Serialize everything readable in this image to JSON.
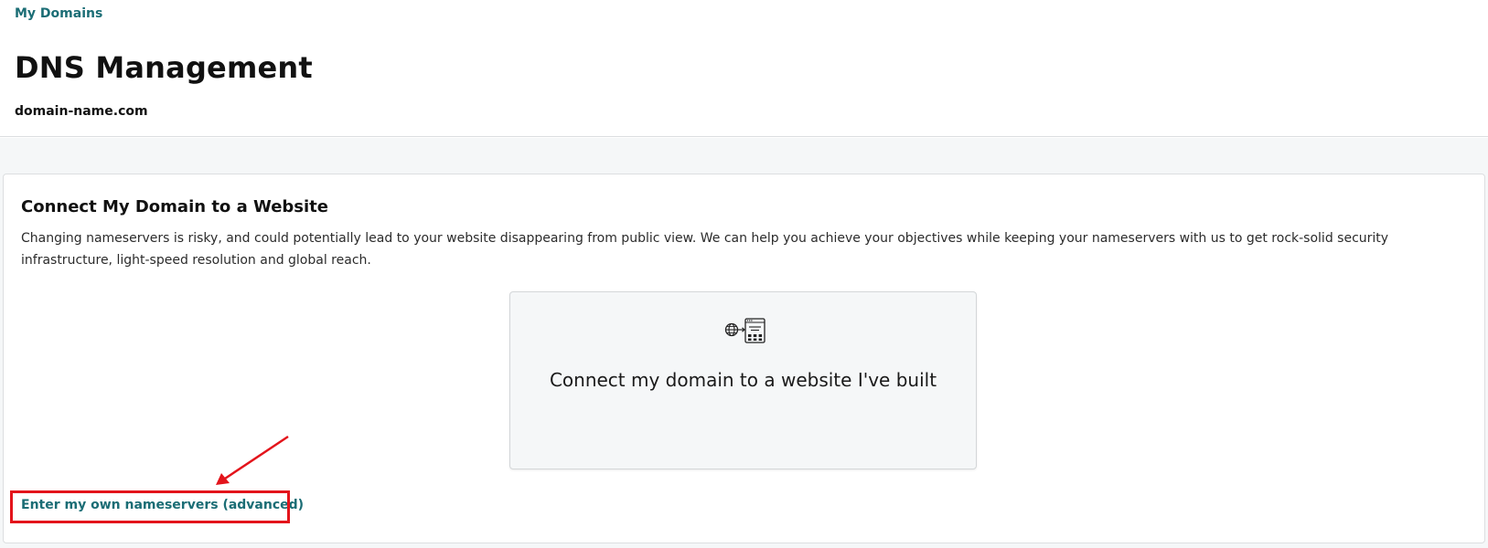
{
  "header": {
    "breadcrumb": "My Domains",
    "title": "DNS Management",
    "domain": "domain-name.com"
  },
  "card": {
    "title": "Connect My Domain to a Website",
    "description": "Changing nameservers is risky, and could potentially lead to your website disappearing from public view. We can help you achieve your objectives while keeping your nameservers with us to get rock-solid security infrastructure, light-speed resolution and global reach.",
    "option": {
      "icon": "globe-to-website-icon",
      "label": "Connect my domain to a website I've built"
    },
    "advanced_link": "Enter my own nameservers (advanced)"
  },
  "annotation": {
    "color": "#e3141b"
  },
  "colors": {
    "link": "#1b6d75",
    "page_bg": "#f5f7f8",
    "text": "#111111"
  }
}
